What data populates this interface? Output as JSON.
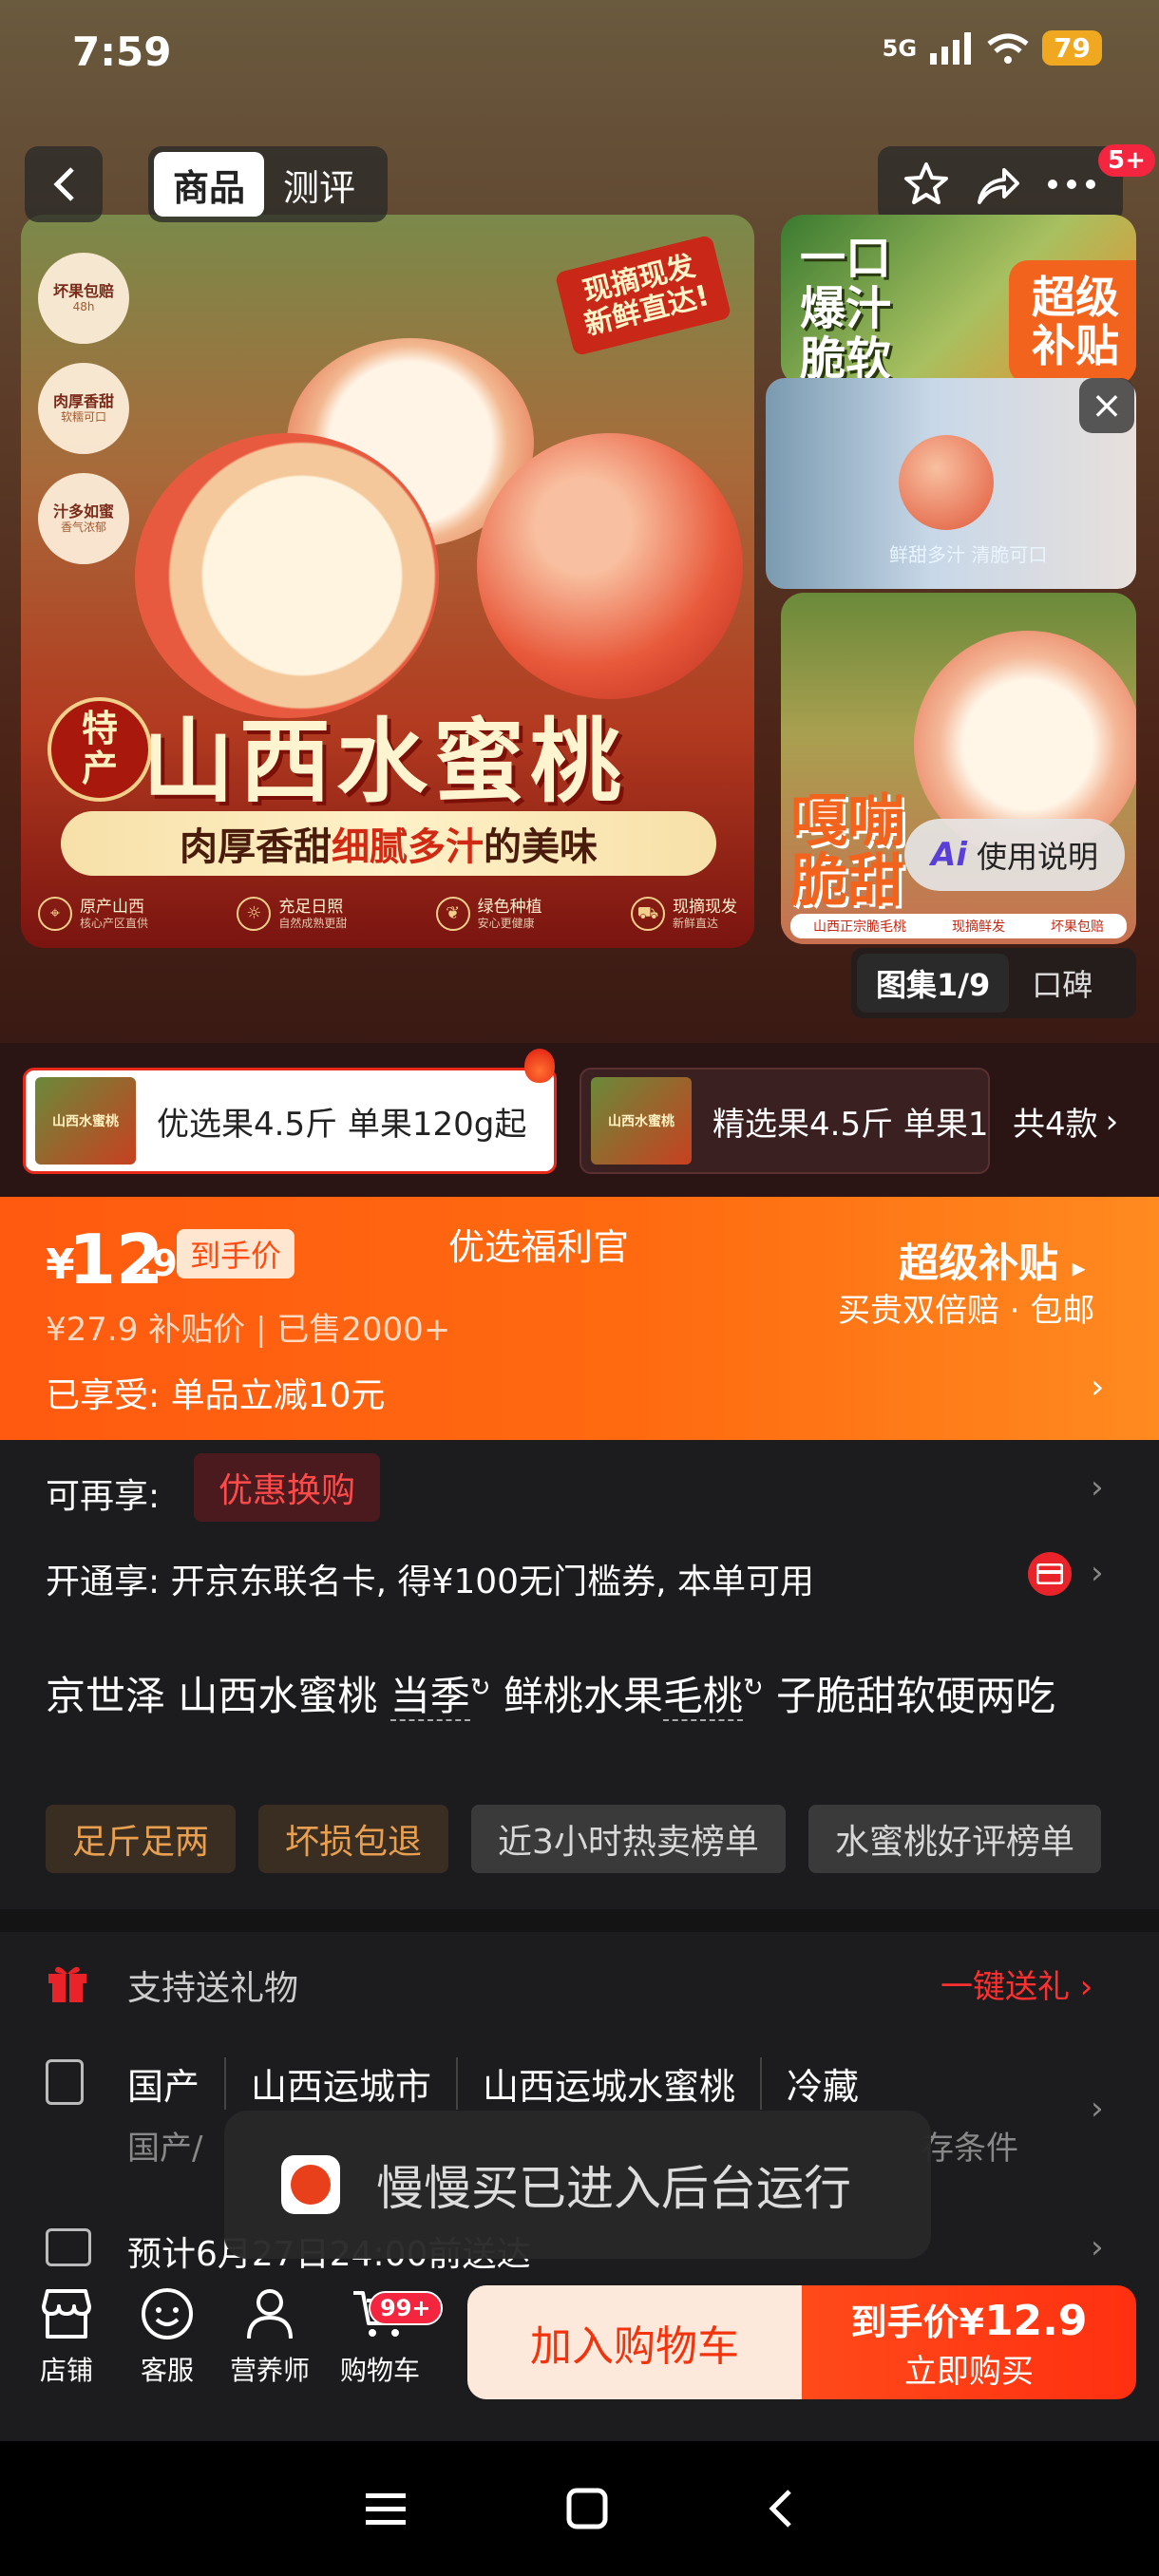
{
  "status_bar": {
    "time": "7:59",
    "network": "5G",
    "battery": "79"
  },
  "top_nav": {
    "tabs": [
      "商品",
      "测评"
    ],
    "message_badge": "5+"
  },
  "main_image": {
    "badges": [
      {
        "title": "坏果包赔",
        "sub": "48h"
      },
      {
        "title": "肉厚香甜",
        "sub": "软糯可口"
      },
      {
        "title": "汁多如蜜",
        "sub": "香气浓郁"
      }
    ],
    "stamp": "现摘现发\n新鲜直达!",
    "seal": "特\n产",
    "title": "山西水蜜桃",
    "slogan_a": "肉厚香甜 ",
    "slogan_b": "细腻多汁",
    "slogan_c": "的美味",
    "features": [
      {
        "title": "原产山西",
        "sub": "核心产区直供"
      },
      {
        "title": "充足日照",
        "sub": "自然成熟更甜"
      },
      {
        "title": "绿色种植",
        "sub": "安心更健康"
      },
      {
        "title": "现摘现发",
        "sub": "新鲜直达"
      }
    ]
  },
  "thumbs": {
    "top_text_a": "一口\n爆汁\n脆软",
    "top_text_b": "超级\n补贴",
    "video_caption": "鲜甜多汁 清脆可口",
    "bottom_text": "嘎嘣\n脆甜",
    "bottom_footer": [
      "山西正宗脆毛桃",
      "现摘鲜发",
      "坏果包赔"
    ]
  },
  "ai_guide": {
    "ai": "Ai",
    "label": "使用说明"
  },
  "gallery": {
    "active": "图集1/9",
    "other": "口碑"
  },
  "variants": {
    "items": [
      "优选果4.5斤 单果120g起",
      "精选果4.5斤 单果1"
    ],
    "thumb_label": "山西水蜜桃",
    "count": "共4款"
  },
  "price": {
    "currency": "¥",
    "main": "12",
    "decimal": ".9",
    "tag": "到手价",
    "welfare": "优选福利官",
    "subsidy_title": "超级补贴",
    "subsidy_sub": "买贵双倍赔 · 包邮",
    "original": "¥27.9 补贴价 | 已售2000+",
    "enjoyed": "已享受: 单品立减10元"
  },
  "coupon": {
    "label": "可再享:",
    "tag": "优惠换购"
  },
  "member": {
    "text": "开通享: 开京东联名卡, 得¥100无门槛券, 本单可用"
  },
  "title": {
    "part1": "京世泽 山西水蜜桃 ",
    "part2": "当季",
    "part3": " 鲜桃水果",
    "part4": "毛桃",
    "part5": " 子脆甜软硬两吃"
  },
  "tags": [
    {
      "label": "足斤足两",
      "style": "gold"
    },
    {
      "label": "坏损包退",
      "style": "gold"
    },
    {
      "label": "近3小时热卖榜单",
      "style": "gray"
    },
    {
      "label": "水蜜桃好评榜单",
      "style": "gray"
    }
  ],
  "gift": {
    "label": "支持送礼物",
    "link": "一键送礼 ›"
  },
  "specs": {
    "items": [
      "国产",
      "山西运城市",
      "山西运城水蜜桃",
      "冷藏"
    ],
    "sub_left": "国产/",
    "sub_right": "存条件"
  },
  "delivery": {
    "text": "预计6月27日24:00前送达"
  },
  "toast": {
    "text": "慢慢买已进入后台运行"
  },
  "bottom": {
    "items": [
      "店铺",
      "客服",
      "营养师",
      "购物车"
    ],
    "cart_badge": "99+",
    "add_cart": "加入购物车",
    "buy_prefix": "到手价¥",
    "buy_price": "12.9",
    "buy_label": "立即购买"
  },
  "colors": {
    "accent": "#ff5a10",
    "red": "#f3253f",
    "buy": "#ff3010"
  }
}
